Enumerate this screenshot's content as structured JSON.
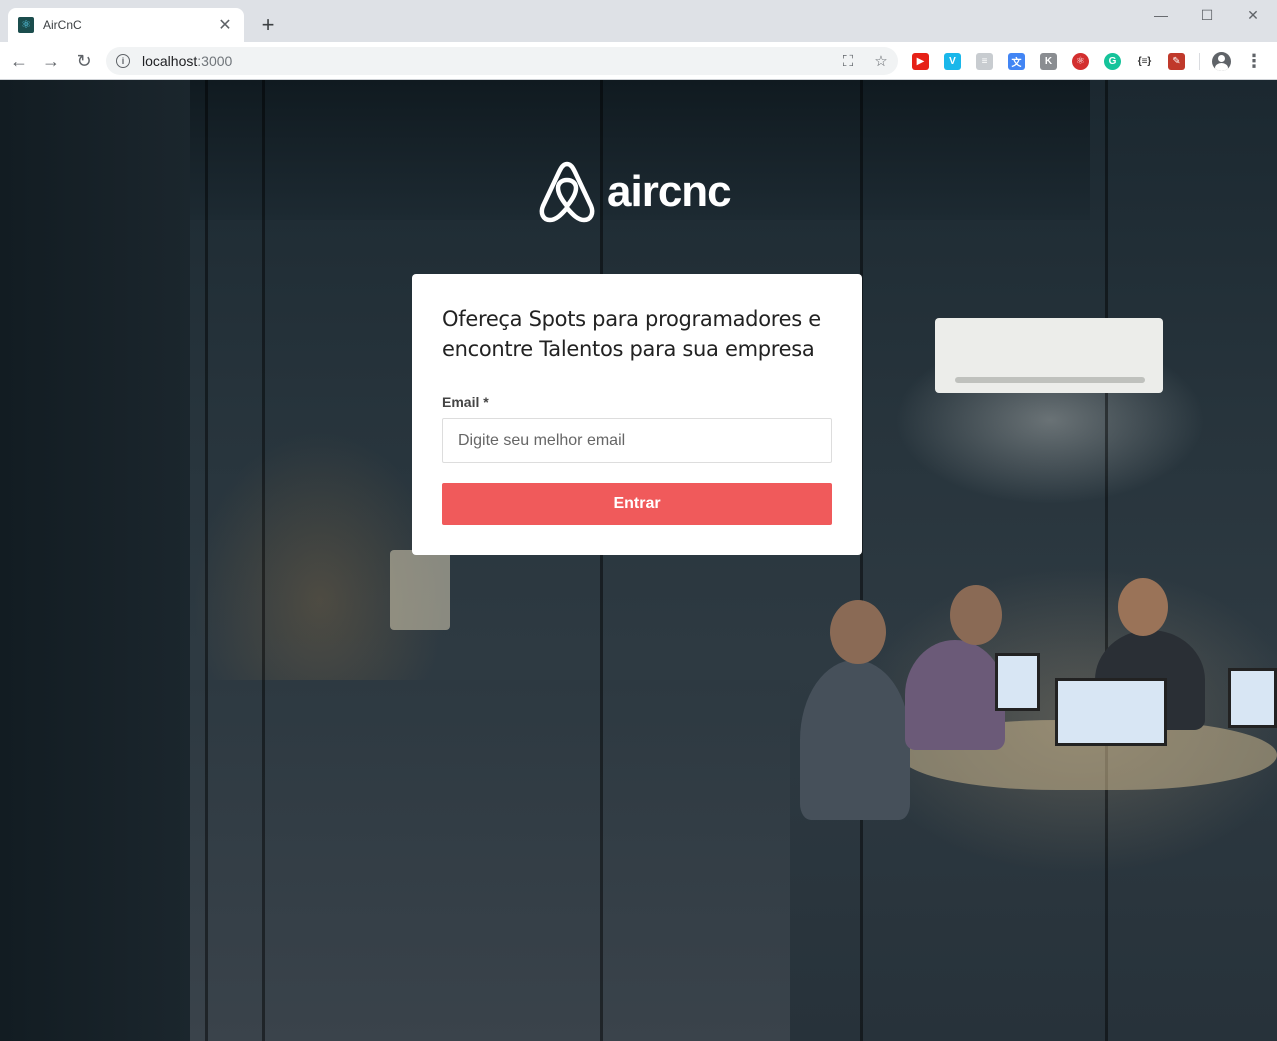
{
  "browser": {
    "tab_title": "AirCnC",
    "new_tab_icon": "plus-icon",
    "url_host": "localhost",
    "url_port": ":3000",
    "window_controls": [
      "minimize",
      "maximize",
      "close"
    ]
  },
  "logo": {
    "text": "aircnc",
    "icon": "airbnb-belo-icon"
  },
  "login": {
    "intro": "Ofereça Spots para programadores e encontre Talentos para sua empresa",
    "email_label": "Email *",
    "email_placeholder": "Digite seu melhor email",
    "email_value": "",
    "submit_label": "Entrar",
    "accent_color": "#f05a5b"
  }
}
